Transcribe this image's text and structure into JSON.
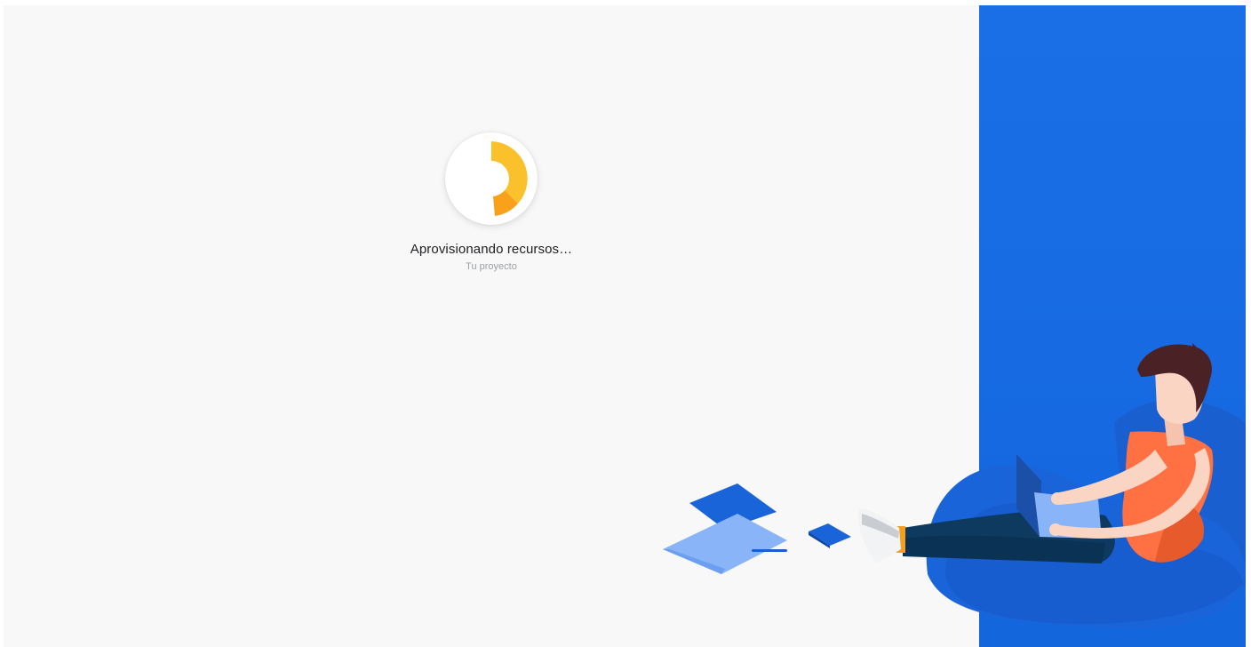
{
  "status": {
    "title": "Aprovisionando recursos…",
    "subtitle": "Tu proyecto"
  },
  "loader": {
    "icon": "progress-spinner-icon",
    "colors": {
      "primary": "#fbc12d",
      "secondary": "#f9a11b",
      "track": "#ffffff"
    }
  },
  "theme": {
    "panel_color": "#1a6fe6",
    "background": "#f8f8f8"
  },
  "illustration": {
    "icon": "person-with-laptop-on-beanbag-illustration"
  }
}
